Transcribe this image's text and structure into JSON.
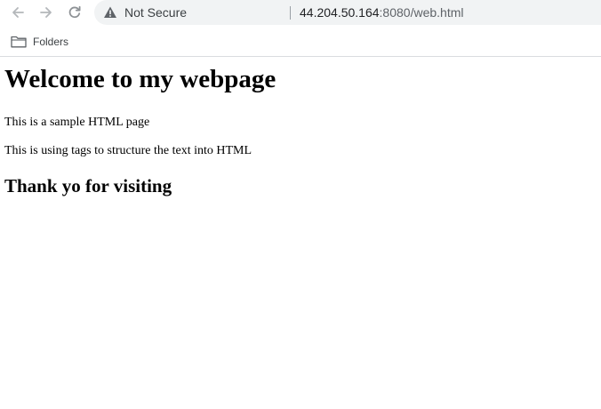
{
  "browser": {
    "nav": {
      "back_icon": "arrow-left-icon",
      "forward_icon": "arrow-right-icon",
      "reload_icon": "reload-icon"
    },
    "omnibox": {
      "security_icon": "warning-triangle-icon",
      "security_label": "Not Secure",
      "url_host": "44.204.50.164",
      "url_rest": ":8080/web.html"
    },
    "bookmarks": [
      {
        "icon": "folder-icon",
        "label": "Folders"
      }
    ]
  },
  "page": {
    "heading": "Welcome to my webpage",
    "paragraph1": "This is a sample HTML page",
    "paragraph2": "This is using tags to structure the text into HTML",
    "subheading": "Thank yo for visiting"
  },
  "colors": {
    "omnibox_bg": "#f1f3f4",
    "chrome_icon": "#a0a4a8",
    "text": "#000000"
  }
}
